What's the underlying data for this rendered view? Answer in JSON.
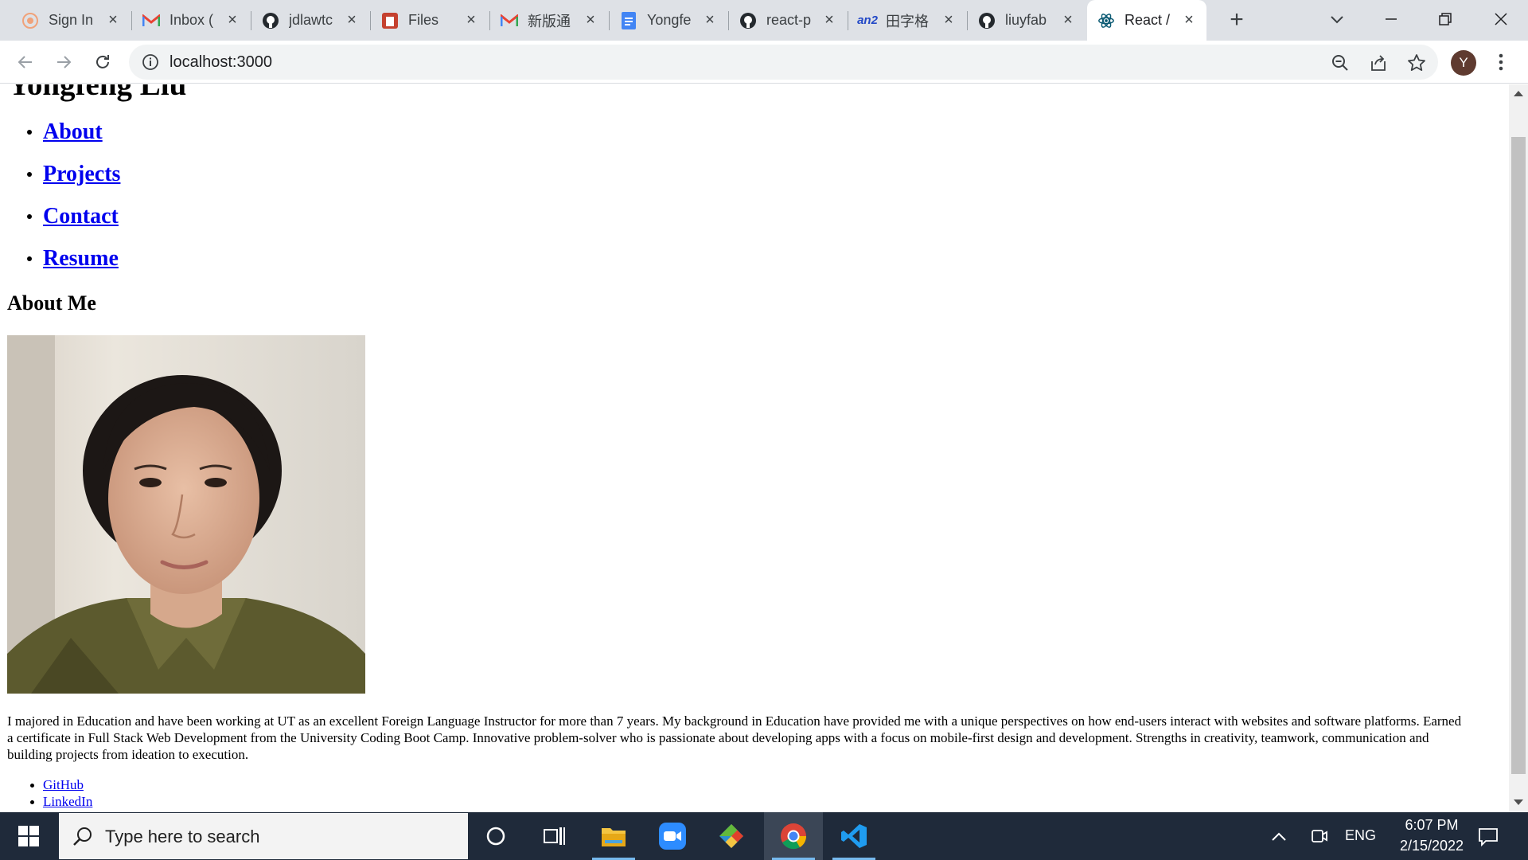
{
  "browser": {
    "tabs": [
      {
        "title": "Sign In",
        "icon": "sign-in-site-icon"
      },
      {
        "title": "Inbox (",
        "icon": "gmail-icon"
      },
      {
        "title": "jdlawtc",
        "icon": "github-icon"
      },
      {
        "title": "Files",
        "icon": "files-icon"
      },
      {
        "title": "新版通",
        "icon": "gmail-icon"
      },
      {
        "title": "Yongfe",
        "icon": "google-docs-icon"
      },
      {
        "title": "react-p",
        "icon": "github-icon"
      },
      {
        "title": "田字格",
        "icon": "an2-icon"
      },
      {
        "title": "liuyfab",
        "icon": "github-icon"
      },
      {
        "title": "React /",
        "icon": "react-icon"
      }
    ],
    "address": "localhost:3000",
    "profile_initial": "Y"
  },
  "page": {
    "name_heading": "Yongfeng Liu",
    "nav": [
      "About",
      "Projects",
      "Contact",
      "Resume"
    ],
    "about_heading": "About Me",
    "bio": "I majored in Education and have been working at UT as an excellent Foreign Language Instructor for more than 7 years. My background in Education have provided me with a unique perspectives on how end-users interact with websites and software platforms. Earned a certificate in Full Stack Web Development from the University Coding Boot Camp. Innovative problem-solver who is passionate about developing apps with a focus on mobile-first design and development. Strengths in creativity, teamwork, communication and building projects from ideation to execution.",
    "social_links": [
      "GitHub",
      "LinkedIn"
    ]
  },
  "taskbar": {
    "search_placeholder": "Type here to search",
    "apps": [
      "cortana-icon",
      "task-view-icon",
      "file-explorer-icon",
      "zoom-icon",
      "git-icon",
      "chrome-icon",
      "vscode-icon"
    ],
    "language": "ENG",
    "time": "6:07 PM",
    "date": "2/15/2022"
  },
  "colors": {
    "link": "#0000ee",
    "tabstrip": "#dee1e6",
    "taskbar": "#1f2a3a"
  }
}
